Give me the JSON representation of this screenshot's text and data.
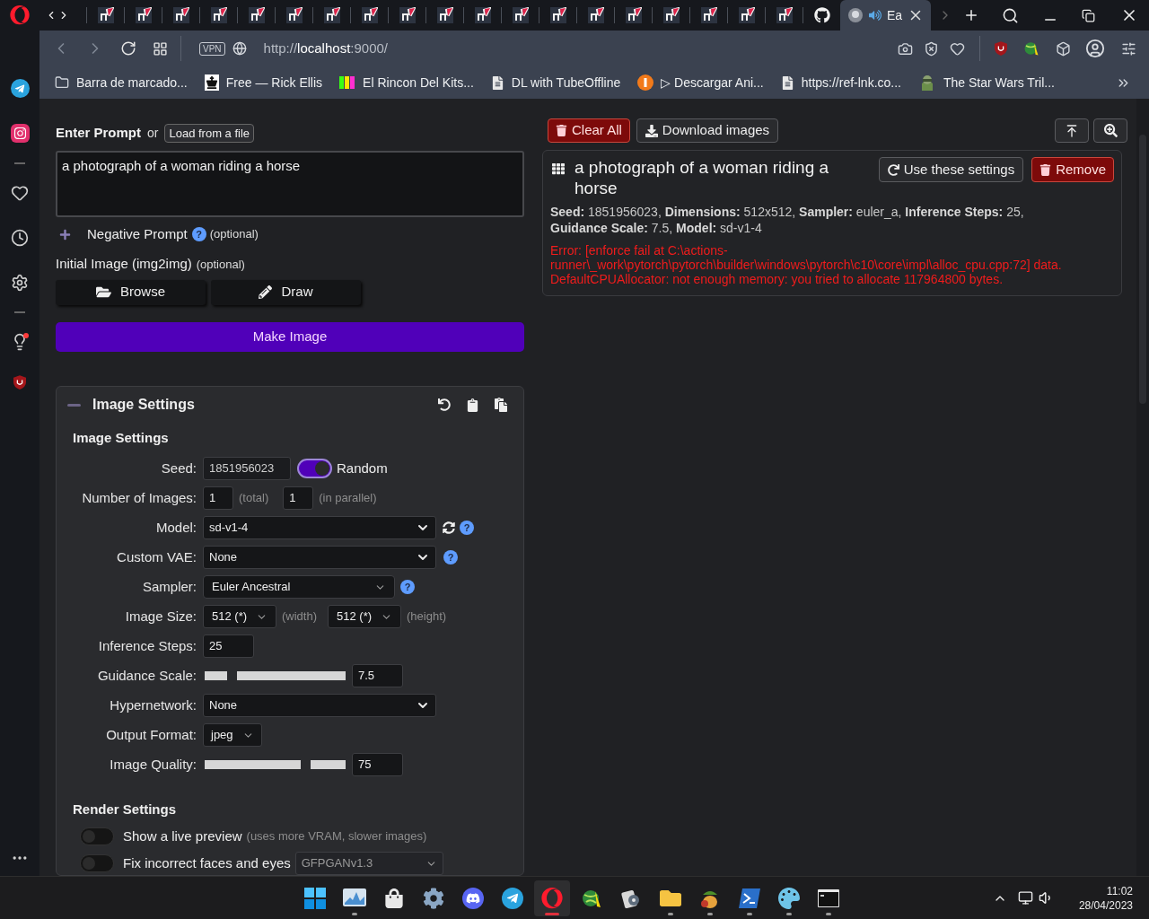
{
  "browser": {
    "tabs": [
      {
        "kind": "n",
        "selected": false
      },
      {
        "kind": "n",
        "selected": false
      },
      {
        "kind": "n",
        "selected": false
      },
      {
        "kind": "n",
        "selected": false
      },
      {
        "kind": "n",
        "selected": false
      },
      {
        "kind": "n",
        "selected": false
      },
      {
        "kind": "n",
        "selected": false
      },
      {
        "kind": "n",
        "selected": false
      },
      {
        "kind": "n",
        "selected": false
      },
      {
        "kind": "n",
        "selected": false
      },
      {
        "kind": "n",
        "selected": false
      },
      {
        "kind": "n",
        "selected": false
      },
      {
        "kind": "n",
        "selected": false
      },
      {
        "kind": "n",
        "selected": false
      },
      {
        "kind": "n",
        "selected": false
      },
      {
        "kind": "n",
        "selected": false
      },
      {
        "kind": "n",
        "selected": false
      },
      {
        "kind": "n",
        "selected": false
      },
      {
        "kind": "n",
        "selected": false
      },
      {
        "kind": "github",
        "selected": false
      },
      {
        "kind": "page",
        "title": "Ea",
        "selected": true
      }
    ],
    "vpn": "VPN",
    "address_scheme": "http://",
    "address_host": "localhost",
    "address_rest": ":9000/",
    "bookmarks": [
      {
        "kind": "folder",
        "label": "Barra de marcado..."
      },
      {
        "kind": "chess",
        "label": "Free — Rick Ellis"
      },
      {
        "kind": "neo",
        "label": "El Rincon Del Kits..."
      },
      {
        "kind": "doc",
        "label": "DL with TubeOffline"
      },
      {
        "kind": "orange",
        "label": "▷ Descargar Ani..."
      },
      {
        "kind": "doc",
        "label": "https://ref-lnk.co..."
      },
      {
        "kind": "figure",
        "label": "The Star Wars Tril..."
      }
    ]
  },
  "prompt": {
    "label": "Enter Prompt",
    "joiner": "or",
    "load_button": "Load from a file",
    "value": "a photograph of a woman riding a horse"
  },
  "negative_prompt": {
    "label": "Negative Prompt",
    "help": "?",
    "hint": "(optional)",
    "expanded": false
  },
  "initial_image": {
    "label": "Initial Image (img2img)",
    "hint": "(optional)",
    "buttons": [
      {
        "kind": "browse",
        "label": "Browse"
      },
      {
        "kind": "draw",
        "label": "Draw"
      }
    ]
  },
  "make_button": "Make Image",
  "settings": {
    "title": "Image Settings",
    "expanded": true,
    "subtitle": "Image Settings",
    "fields": [
      {
        "kind": "seed",
        "label": "Seed:",
        "value": "1851956023",
        "random": true,
        "random_label": "Random"
      },
      {
        "kind": "pair",
        "label": "Number of Images:",
        "values": [
          {
            "value": "1",
            "hint": "(total)"
          },
          {
            "value": "1",
            "hint": "(in parallel)"
          }
        ]
      },
      {
        "kind": "select",
        "label": "Model:",
        "value": "sd-v1-4",
        "refresh": true,
        "help": "?"
      },
      {
        "kind": "select",
        "label": "Custom VAE:",
        "value": "None",
        "help": "?"
      },
      {
        "kind": "sampler",
        "label": "Sampler:",
        "value": "Euler Ancestral",
        "help": "?"
      },
      {
        "kind": "size",
        "label": "Image Size:",
        "values": [
          {
            "value": "512 (*)",
            "hint": "(width)"
          },
          {
            "value": "512 (*)",
            "hint": "(height)"
          }
        ]
      },
      {
        "kind": "number",
        "label": "Inference Steps:",
        "value": "25"
      },
      {
        "kind": "slider",
        "label": "Guidance Scale:",
        "level": 0.17,
        "value": "7.5"
      },
      {
        "kind": "select",
        "label": "Hypernetwork:",
        "value": "None"
      },
      {
        "kind": "format",
        "label": "Output Format:",
        "value": "jpeg"
      },
      {
        "kind": "slider",
        "label": "Image Quality:",
        "level": 0.73,
        "value": "75"
      }
    ],
    "render_title": "Render Settings",
    "render_options": [
      {
        "label": "Show a live preview",
        "hint": "(uses more VRAM, slower images)",
        "on": false
      },
      {
        "label": "Fix incorrect faces and eyes",
        "select": "GFPGANv1.3",
        "on": false
      }
    ]
  },
  "toolbar": {
    "clear": "Clear All",
    "download": "Download images"
  },
  "task": {
    "title": "a photograph of a woman riding a horse",
    "use_button": "Use these settings",
    "remove_button": "Remove",
    "details": "**Seed:** 1851956023, **Dimensions:** 512x512, **Sampler:** euler_a, **Inference Steps:** 25, **Guidance Scale:** 7.5, **Model:** sd-v1-4",
    "error": "Error: [enforce fail at C:\\actions-runner\\_work\\pytorch\\pytorch\\builder\\windows\\pytorch\\c10\\core\\impl\\alloc_cpu.cpp:72] data. DefaultCPUAllocator: not enough memory: you tried to allocate 117964800 bytes."
  },
  "taskbar": {
    "apps": [
      {
        "kind": "start",
        "running": false,
        "selected": false
      },
      {
        "kind": "monitor",
        "running": true,
        "selected": false
      },
      {
        "kind": "store",
        "running": false,
        "selected": false
      },
      {
        "kind": "settings",
        "running": false,
        "selected": false
      },
      {
        "kind": "discord",
        "running": false,
        "selected": false
      },
      {
        "kind": "telegram",
        "running": false,
        "selected": false
      },
      {
        "kind": "opera",
        "running": true,
        "selected": true
      },
      {
        "kind": "globe",
        "running": false,
        "selected": false
      },
      {
        "kind": "media",
        "running": false,
        "selected": false
      },
      {
        "kind": "folder",
        "running": true,
        "selected": false
      },
      {
        "kind": "fruit",
        "running": true,
        "selected": false
      },
      {
        "kind": "shell",
        "running": true,
        "selected": false
      },
      {
        "kind": "paint",
        "running": true,
        "selected": false
      },
      {
        "kind": "terminal",
        "running": true,
        "selected": false
      }
    ],
    "time": "11:02",
    "date": "28/04/2023"
  }
}
